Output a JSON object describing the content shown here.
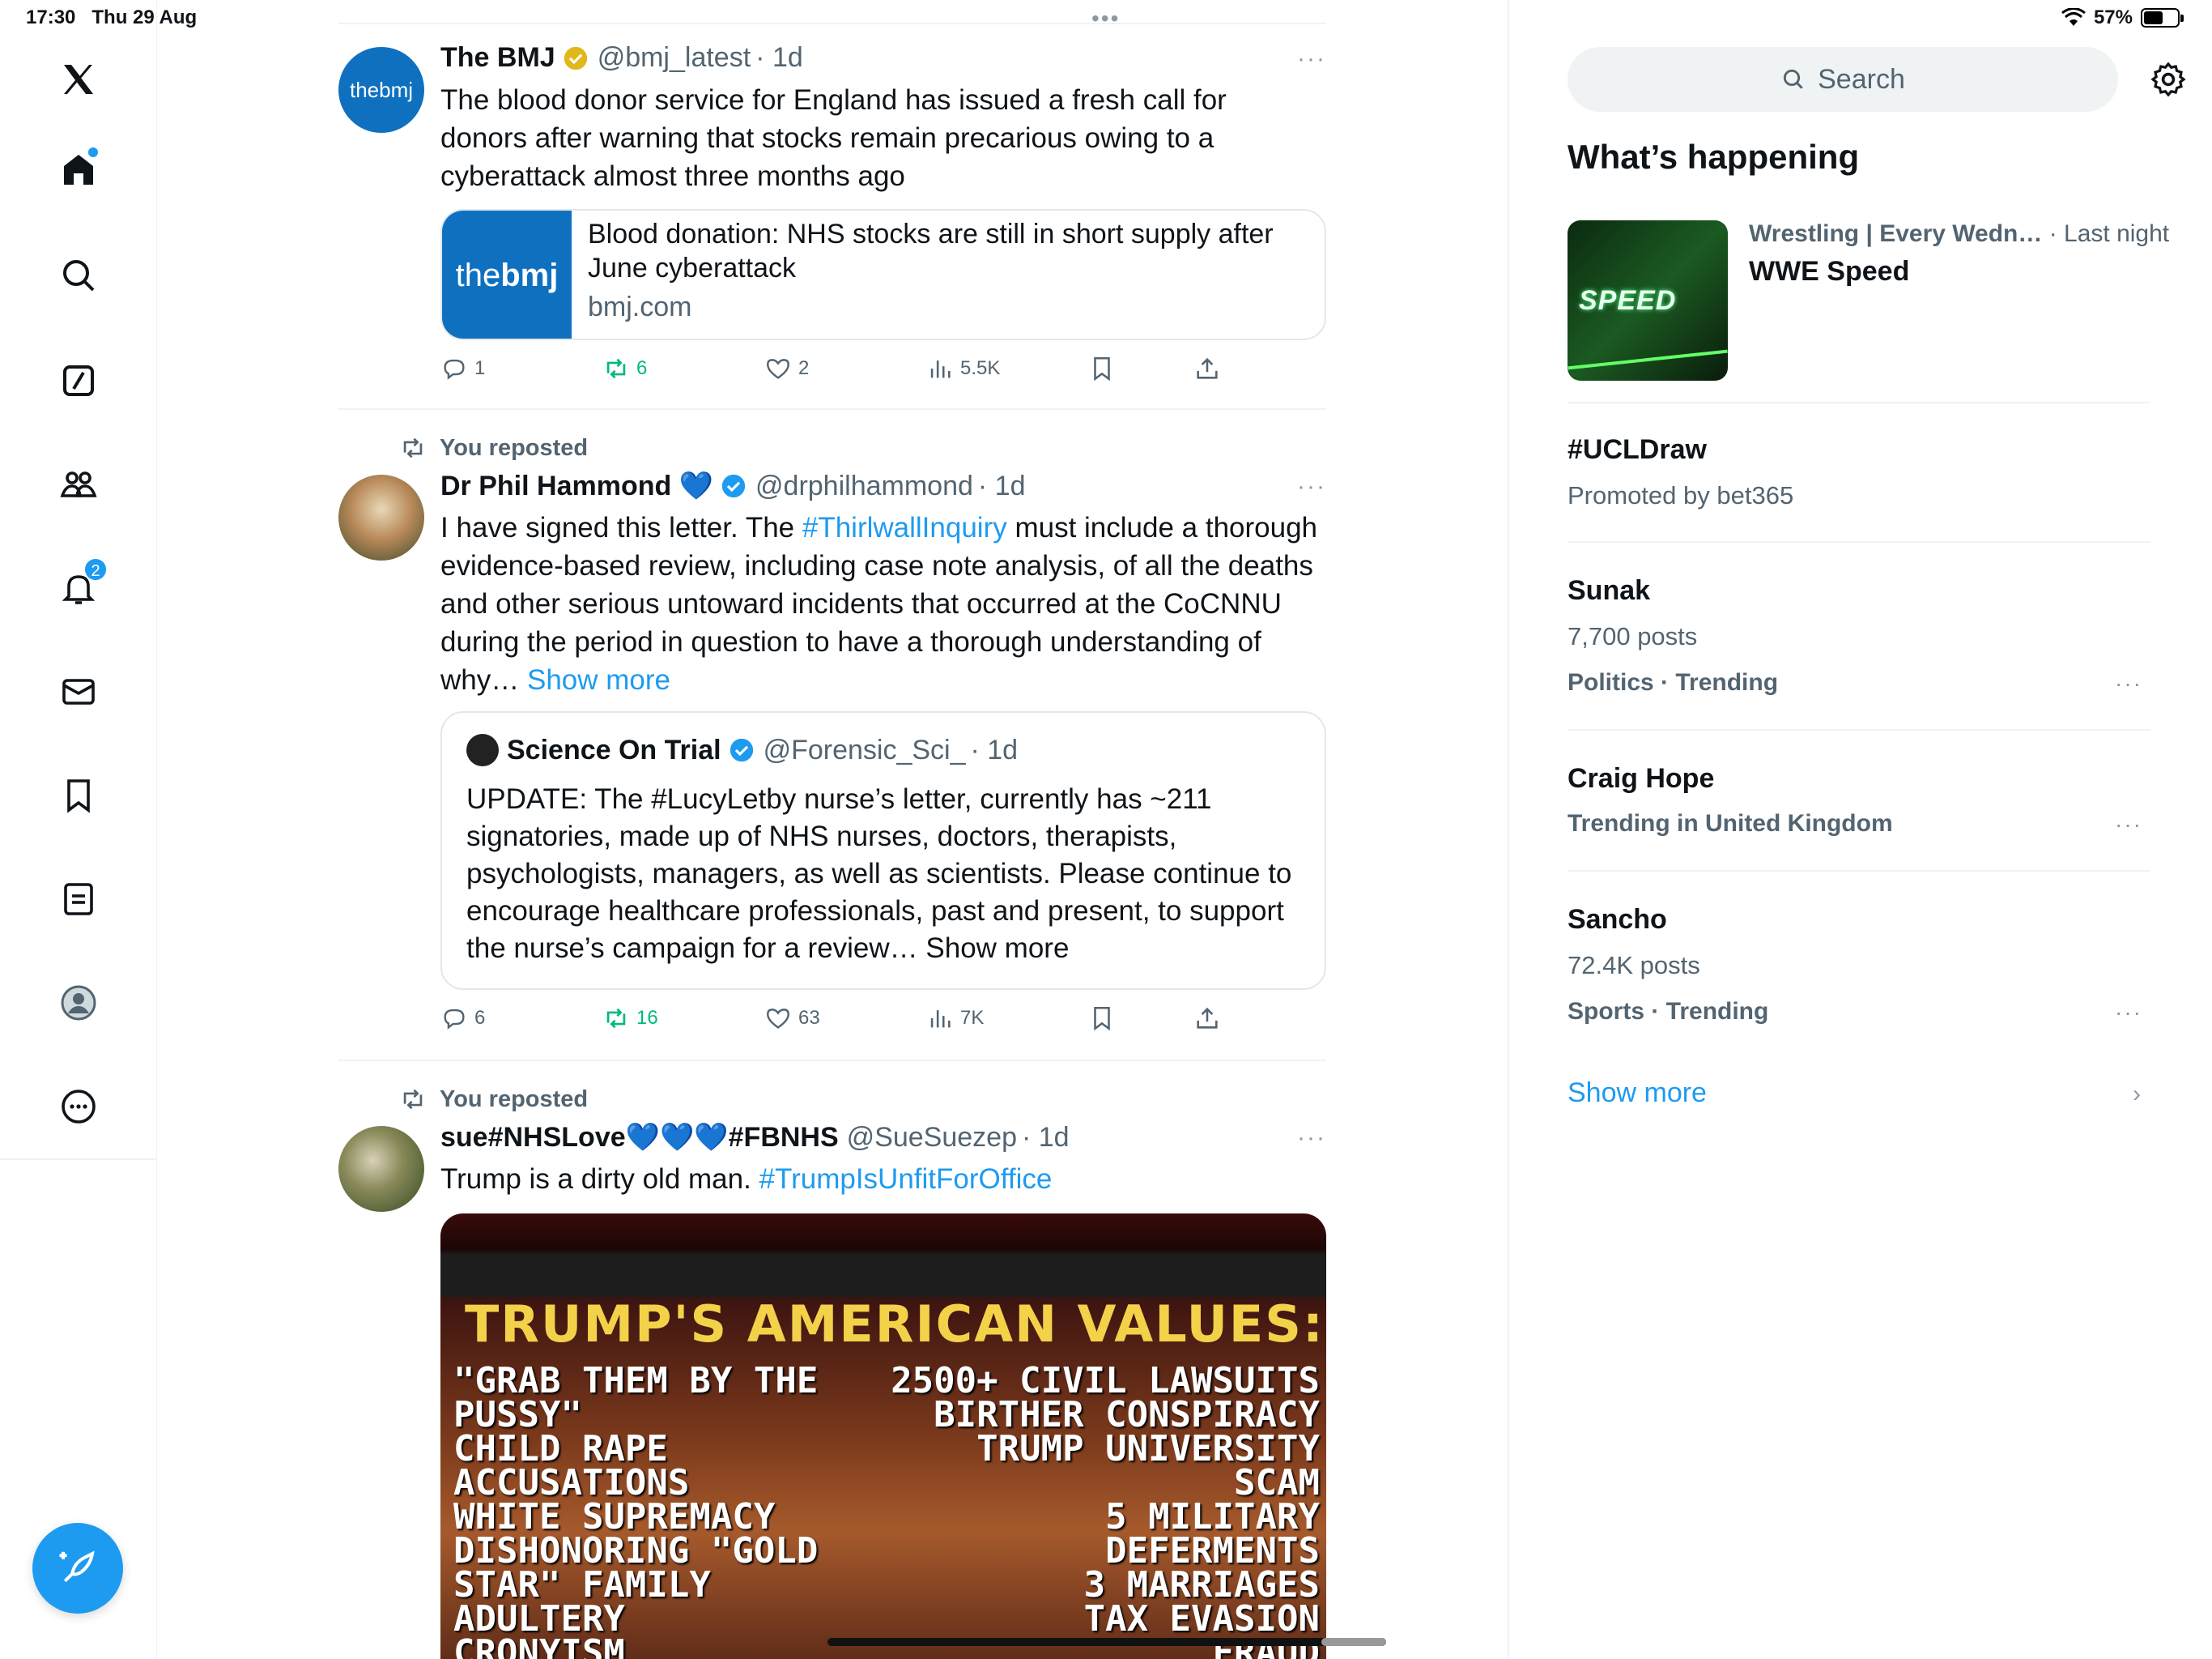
{
  "status": {
    "time": "17:30",
    "date": "Thu 29 Aug",
    "battery": "57%",
    "battery_level": 0.57
  },
  "nav": {
    "items": [
      "x-logo",
      "home",
      "explore",
      "grok",
      "communities",
      "notifications",
      "messages",
      "bookmarks",
      "lists",
      "profile",
      "more"
    ],
    "notifications_badge": "2",
    "compose_icon": "compose-icon"
  },
  "timeline": {
    "tweets": [
      {
        "name": "The BMJ",
        "handle": "@bmj_latest",
        "time": "· 1d",
        "avatar_text": "thebmj",
        "text": "The blood donor service for England has issued a fresh call for donors after warning that stocks remain precarious owing to a cyberattack almost three months ago",
        "card": {
          "thumb_text_light": "the",
          "thumb_text_bold": "bmj",
          "title": "Blood donation: NHS stocks are still in short supply after June cyberattack",
          "domain": "bmj.com"
        },
        "stats": {
          "replies": "1",
          "reposts": "6",
          "likes": "2",
          "views": "5.5K"
        }
      },
      {
        "repost_label": "You reposted",
        "name": "Dr Phil Hammond 💙",
        "handle": "@drphilhammond",
        "time": "· 1d",
        "text_before": "I have signed this letter. The ",
        "hashtag": "#ThirlwallInquiry",
        "text_after": " must include a thorough evidence-based review, including case note analysis, of all the deaths and other serious untoward incidents that occurred at the CoCNNU during the period in question to have a thorough understanding of why… ",
        "show_more": "Show more",
        "quote": {
          "name": "Science On Trial",
          "handle": "@Forensic_Sci_",
          "time": "· 1d",
          "text": "UPDATE: The #LucyLetby nurse’s letter, currently has ~211 signatories, made up of NHS nurses, doctors, therapists, psychologists, managers, as well as scientists. Please continue to encourage healthcare professionals, past and present, to support the nurse’s campaign for a review… Show more"
        },
        "stats": {
          "replies": "6",
          "reposts": "16",
          "likes": "63",
          "views": "7K"
        }
      },
      {
        "repost_label": "You reposted",
        "name": "sue#NHSLove💙💙💙#FBNHS",
        "handle": "@SueSuezep",
        "time": "· 1d",
        "text_before": "Trump is a dirty old man.  ",
        "hashtag": "#TrumpIsUnfitForOffice",
        "media": {
          "title": "TRUMP'S AMERICAN VALUES:",
          "left_lines": "\"GRAB THEM BY THE\nPUSSY\"\nCHILD RAPE\nACCUSATIONS\nWHITE SUPREMACY\nDISHONORING \"GOLD\nSTAR\" FAMILY\nADULTERY\nCRONYISM",
          "right_lines": "2500+ CIVIL LAWSUITS\nBIRTHER CONSPIRACY\nTRUMP UNIVERSITY\nSCAM\n5 MILITARY\nDEFERMENTS\n3 MARRIAGES\nTAX EVASION\nFRAUD"
        }
      }
    ]
  },
  "sidebar": {
    "search_placeholder": "Search",
    "whats_happening": "What’s happening",
    "featured": {
      "category": "Wrestling | Every Wedn…",
      "when": "· Last night",
      "title": "WWE Speed",
      "image_text": "SPEED"
    },
    "trends": [
      {
        "title": "#UCLDraw",
        "sub": "Promoted by bet365"
      },
      {
        "title": "Sunak",
        "posts": "7,700 posts",
        "context": "Politics · Trending"
      },
      {
        "title": "Craig Hope",
        "context": "Trending in United Kingdom"
      },
      {
        "title": "Sancho",
        "posts": "72.4K posts",
        "context": "Sports · Trending"
      }
    ],
    "show_more": "Show more"
  }
}
